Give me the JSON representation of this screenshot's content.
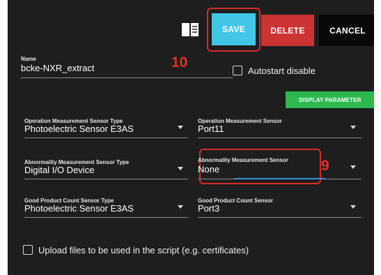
{
  "toolbar": {
    "doc_icon": "book-icon",
    "save_label": "SAVE",
    "delete_label": "DELETE",
    "cancel_label": "CANCEL",
    "colors": {
      "save": "#41c6e8",
      "delete": "#cc3333",
      "cancel": "#080808"
    }
  },
  "annotations": {
    "step_save": "10",
    "step_abnormality": "9"
  },
  "name_field": {
    "label": "Name",
    "value": "bcke-NXR_extract"
  },
  "autostart": {
    "label": "Autostart disable",
    "checked": false
  },
  "display_parameter_label": "DISPLAY PARAMETER",
  "fields": {
    "op_type": {
      "label": "Operation Measurement Sensor Type",
      "value": "Photoelectric Sensor E3AS"
    },
    "op_sensor": {
      "label": "Operation Measurement Sensor",
      "value": "Port11"
    },
    "abn_type": {
      "label": "Abnormality Measurement Sensor Type",
      "value": "Digital I/O Device"
    },
    "abn_sensor": {
      "label": "Abnormality Measurement Sensor",
      "value": "None"
    },
    "good_type": {
      "label": "Good Product Count Sensor Type",
      "value": "Photoelectric Sensor E3AS"
    },
    "good_sensor": {
      "label": "Good Product Count Sensor",
      "value": "Port3"
    }
  },
  "upload": {
    "label": "Upload files to be used in the script (e.g. certificates)",
    "checked": false
  }
}
